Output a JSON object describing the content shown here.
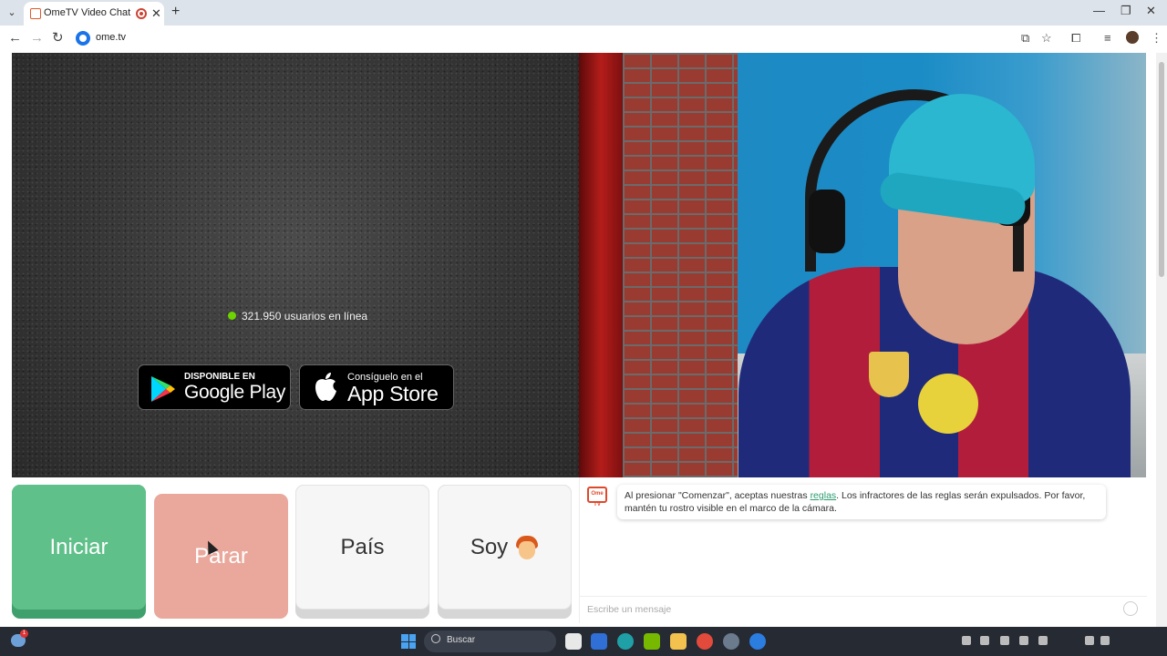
{
  "browser": {
    "tab_title": "OmeTV Video Chat — Ome",
    "url": "ome.tv"
  },
  "video": {
    "online_count_text": "321.950 usuarios en línea",
    "google_play": {
      "small": "DISPONIBLE EN",
      "big": "Google Play"
    },
    "app_store": {
      "small": "Consíguelo en el",
      "big": "App Store"
    }
  },
  "controls": {
    "start_label": "Iniciar",
    "stop_label": "Parar",
    "country_label": "País",
    "soy_label": "Soy"
  },
  "chat": {
    "logo_text": "Ome TV",
    "rules_text_before": "Al presionar \"Comenzar\", aceptas nuestras",
    "rules_link": "reglas",
    "rules_text_after": ". Los infractores de las reglas serán expulsados. Por favor, mantén tu rostro visible en el marco de la cámara.",
    "input_placeholder": "Escribe un mensaje"
  },
  "taskbar": {
    "search_placeholder": "Buscar"
  },
  "colors": {
    "start": "#5fc08a",
    "stop": "#e9a89b",
    "online_dot": "#6dd400",
    "link": "#2b9b6f"
  }
}
